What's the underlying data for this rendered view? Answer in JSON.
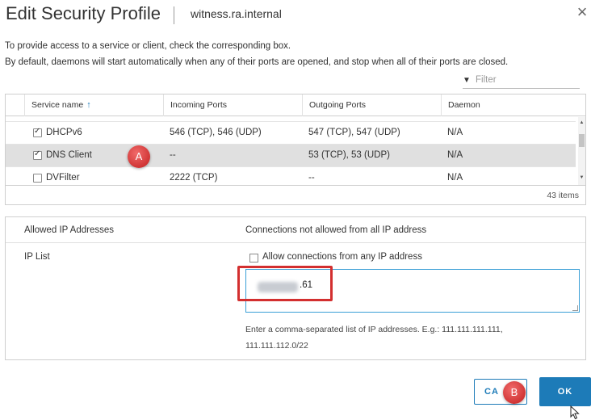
{
  "dialog": {
    "title": "Edit Security Profile",
    "subtitle": "witness.ra.internal",
    "intro_line1": "To provide access to a service or client, check the corresponding box.",
    "intro_line2": "By default, daemons will start automatically when any of their ports are opened, and stop when all of their ports are closed."
  },
  "filter": {
    "placeholder": "Filter",
    "icon": "filter-funnel-icon"
  },
  "table": {
    "columns": [
      "Service name",
      "Incoming Ports",
      "Outgoing Ports",
      "Daemon"
    ],
    "sort_indicator": "↑",
    "rows": [
      {
        "checked": true,
        "name": "DHCPv6",
        "incoming": "546 (TCP), 546 (UDP)",
        "outgoing": "547 (TCP), 547 (UDP)",
        "daemon": "N/A",
        "selected": false
      },
      {
        "checked": true,
        "name": "DNS Client",
        "incoming": "--",
        "outgoing": "53 (TCP), 53 (UDP)",
        "daemon": "N/A",
        "selected": true
      },
      {
        "checked": false,
        "name": "DVFilter",
        "incoming": "2222 (TCP)",
        "outgoing": "--",
        "daemon": "N/A",
        "selected": false
      }
    ],
    "items_count": "43 items"
  },
  "ip_panel": {
    "allowed_label": "Allowed IP Addresses",
    "allowed_value": "Connections not allowed from all IP address",
    "ip_list_label": "IP List",
    "allow_any_label": "Allow connections from any IP address",
    "allow_any_checked": false,
    "ip_value_suffix": ".61",
    "hint_line1": "Enter a comma-separated list of IP addresses. E.g.: 111.111.111.111,",
    "hint_line2": "111.111.112.0/22"
  },
  "annotations": {
    "badge_a": "A",
    "badge_b": "B",
    "color": "#d32f2f"
  },
  "buttons": {
    "cancel": "CA",
    "ok": "OK"
  },
  "colors": {
    "accent": "#1d7bb8",
    "selected_row": "#e0e0e0",
    "annotation_red": "#d32f2f"
  }
}
